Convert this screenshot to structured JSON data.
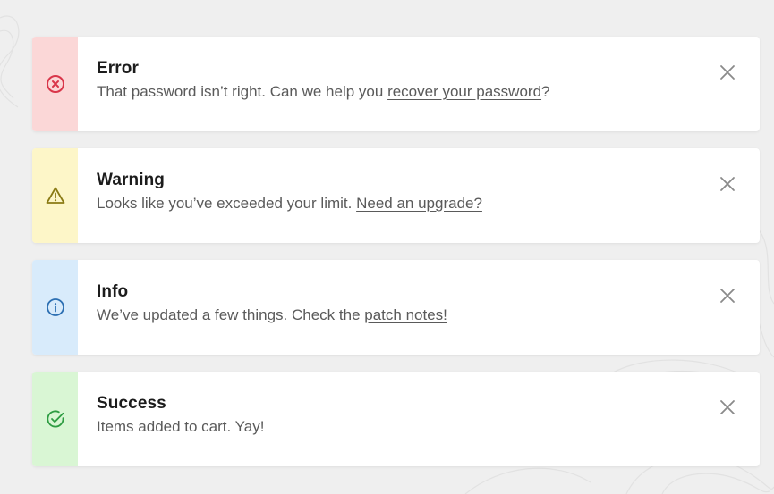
{
  "colors": {
    "page_background": "#efefef",
    "card_background": "#ffffff",
    "error_stripe": "#fbd7d7",
    "error_accent": "#d9364a",
    "warning_stripe": "#fdf6c8",
    "warning_accent": "#8a7a14",
    "info_stripe": "#d8ebfb",
    "info_accent": "#2c6fb2",
    "success_stripe": "#d9f6d4",
    "success_accent": "#2e9c42"
  },
  "alerts": [
    {
      "type": "error",
      "icon": "x-circle-icon",
      "title": "Error",
      "message_prefix": "That password isn’t right. Can we help you ",
      "link_text": "recover your password",
      "message_suffix": "?",
      "close_icon": "close-icon"
    },
    {
      "type": "warning",
      "icon": "warning-triangle-icon",
      "title": "Warning",
      "message_prefix": "Looks like you’ve exceeded your limit. ",
      "link_text": "Need an upgrade?",
      "message_suffix": "",
      "close_icon": "close-icon"
    },
    {
      "type": "info",
      "icon": "info-circle-icon",
      "title": "Info",
      "message_prefix": "We’ve updated a few things. Check the ",
      "link_text": "patch notes!",
      "message_suffix": "",
      "close_icon": "close-icon"
    },
    {
      "type": "success",
      "icon": "check-circle-icon",
      "title": "Success",
      "message_prefix": "Items added to cart. Yay!",
      "link_text": "",
      "message_suffix": "",
      "close_icon": "close-icon"
    }
  ]
}
